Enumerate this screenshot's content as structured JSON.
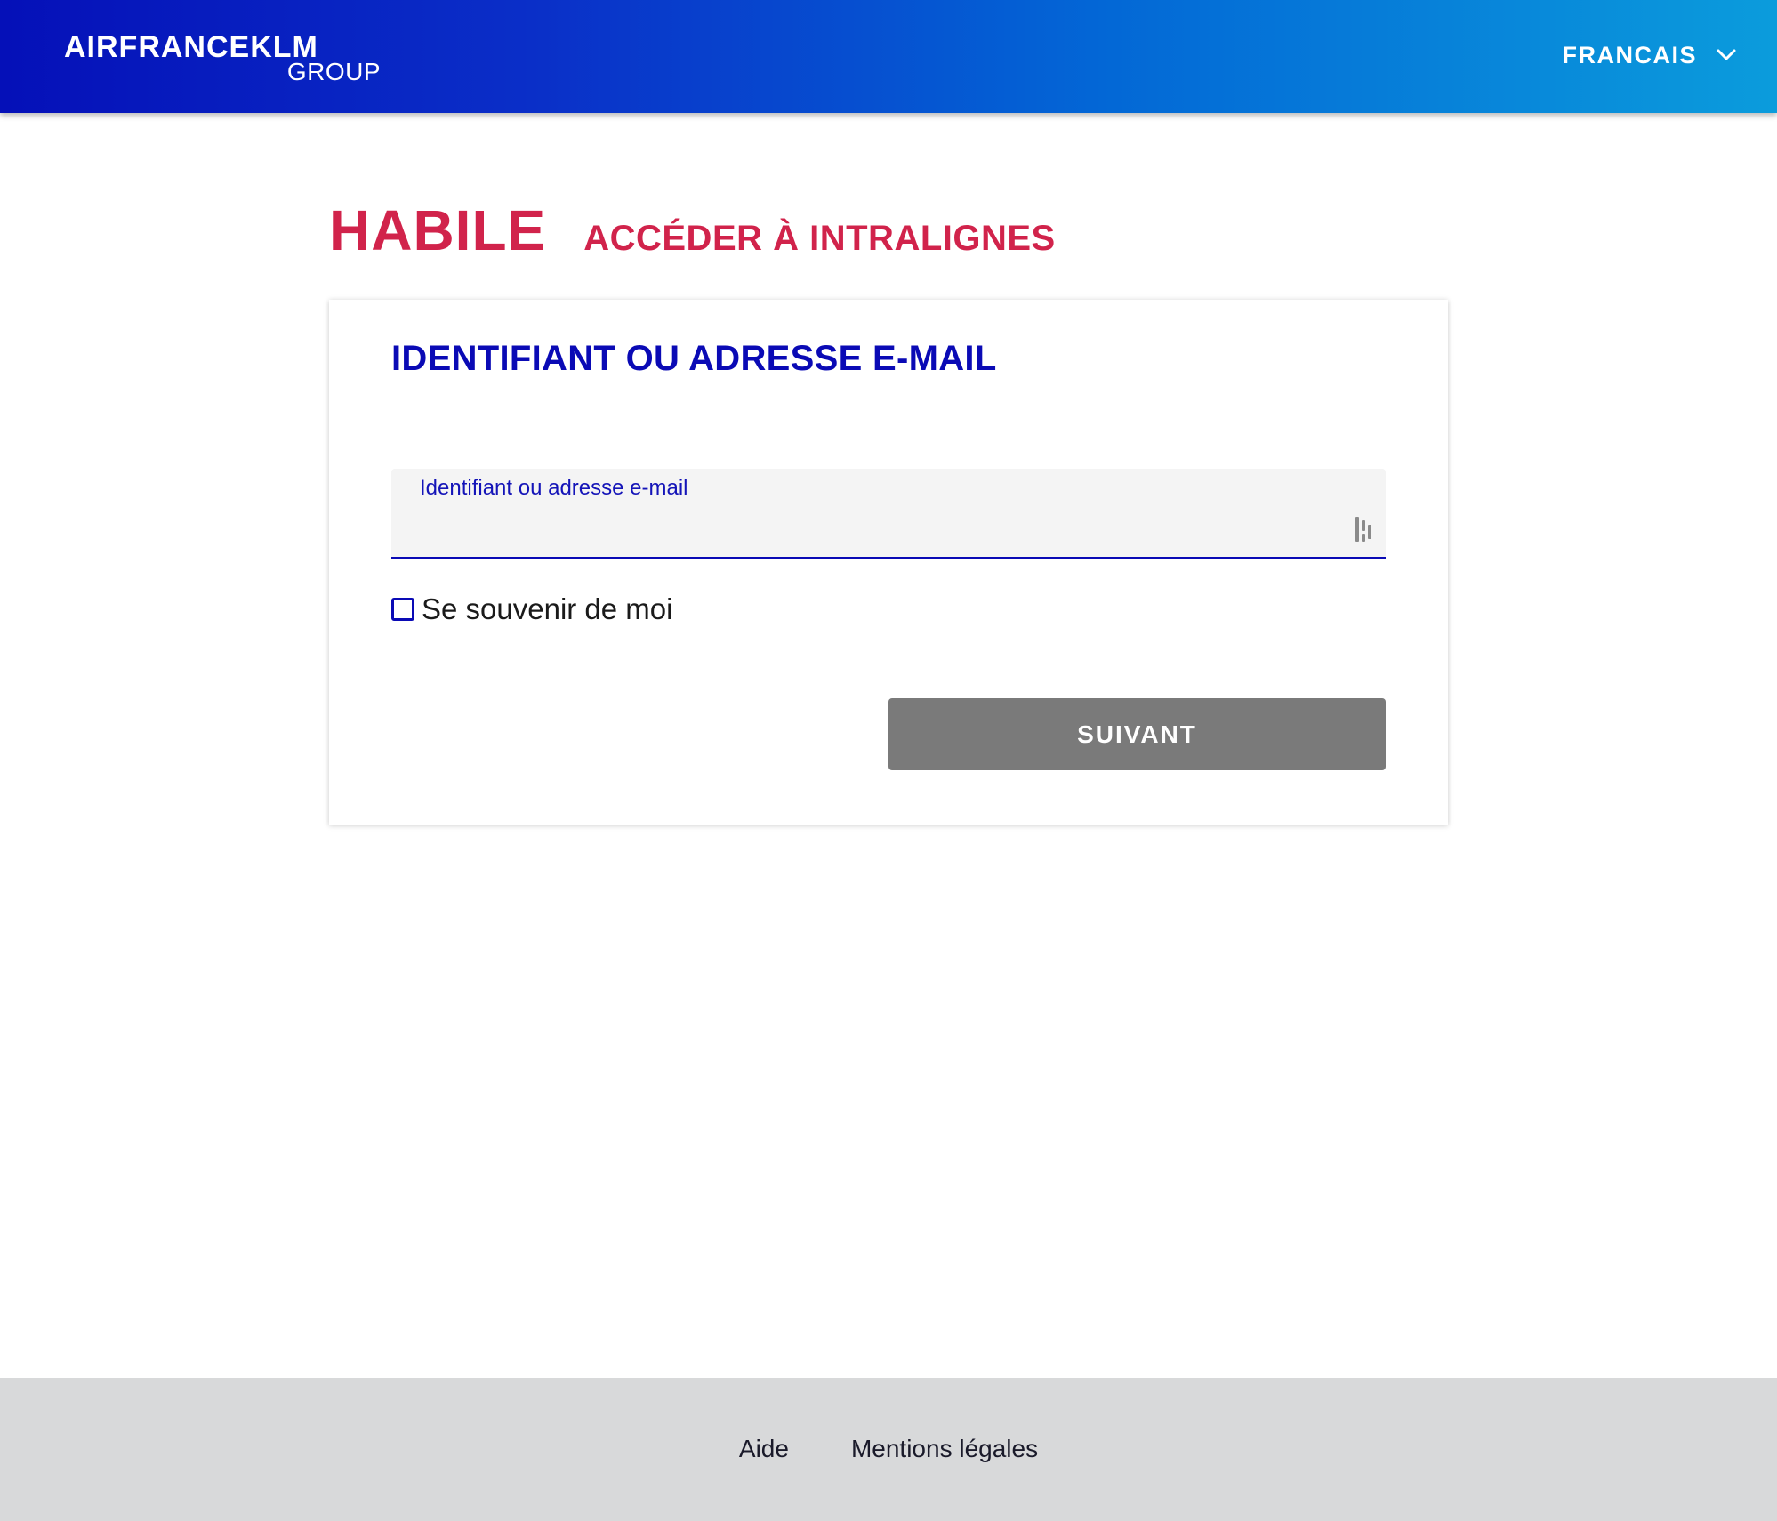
{
  "header": {
    "logo_main": "AIRFRANCEKLM",
    "logo_sub": "GROUP",
    "language_label": "FRANCAIS",
    "language_icon": "chevron-down-icon"
  },
  "page": {
    "title": "HABILE",
    "subtitle": "ACCÉDER À INTRALIGNES"
  },
  "login_card": {
    "heading": "IDENTIFIANT OU ADRESSE E-MAIL",
    "username_label": "Identifiant ou adresse e-mail",
    "username_value": "",
    "field_icon": "password-manager-icon",
    "remember_label": "Se souvenir de moi",
    "remember_checked": false,
    "next_label": "SUIVANT"
  },
  "footer": {
    "links": [
      "Aide",
      "Mentions légales"
    ]
  },
  "colors": {
    "brand_red": "#d1234b",
    "brand_blue": "#0a0ab5",
    "header_gradient_start": "#0510b8",
    "header_gradient_end": "#0b9cdc",
    "button_disabled": "#7a7a7a",
    "footer_bg": "#d8d9da"
  }
}
